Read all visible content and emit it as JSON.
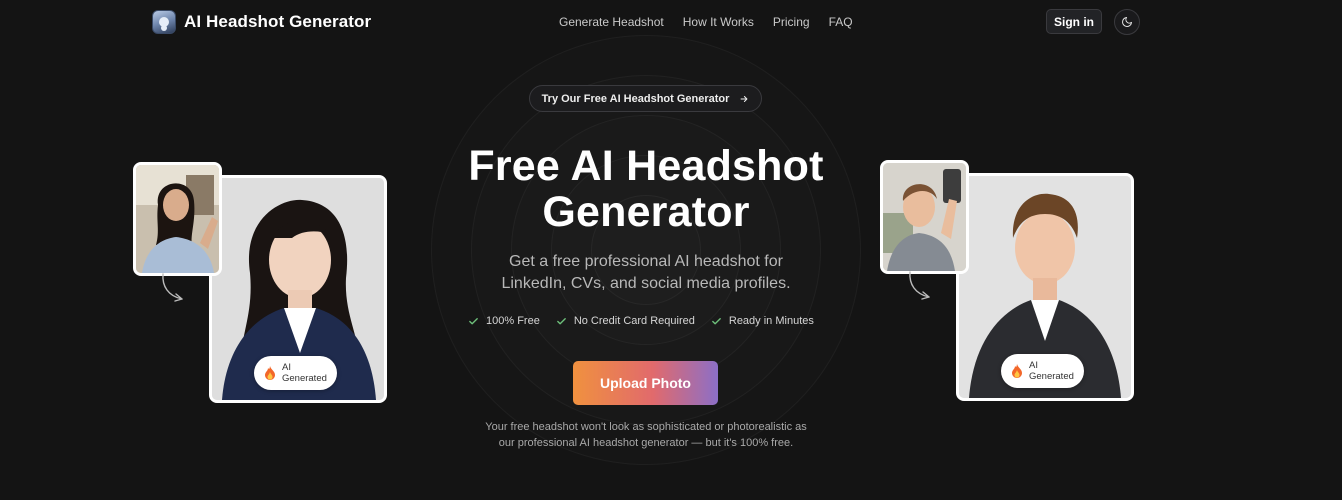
{
  "nav": {
    "brand": "AI Headshot Generator",
    "links": [
      "Generate Headshot",
      "How It Works",
      "Pricing",
      "FAQ"
    ],
    "sign_in": "Sign in"
  },
  "hero": {
    "pill": "Try Our Free AI Headshot Generator",
    "title_line1": "Free AI Headshot",
    "title_line2": "Generator",
    "subtitle_line1": "Get a free professional AI headshot for",
    "subtitle_line2": "LinkedIn, CVs, and social media profiles.",
    "checks": [
      "100% Free",
      "No Credit Card Required",
      "Ready in Minutes"
    ],
    "upload": "Upload Photo",
    "disclaimer_line1": "Your free headshot won't look as sophisticated or photorealistic as",
    "disclaimer_line2": "our professional AI headshot generator — but it's 100% free."
  },
  "examples": {
    "badge_line1": "AI",
    "badge_line2": "Generated"
  },
  "colors": {
    "background": "#141414",
    "check": "#6ec07b",
    "gradient_start": "#f0913f",
    "gradient_mid": "#e16a6c",
    "gradient_end": "#8c6fc7"
  },
  "icons": [
    "logo-icon",
    "arrow-right-icon",
    "moon-icon",
    "check-icon",
    "flame-icon",
    "curved-arrow-icon"
  ]
}
